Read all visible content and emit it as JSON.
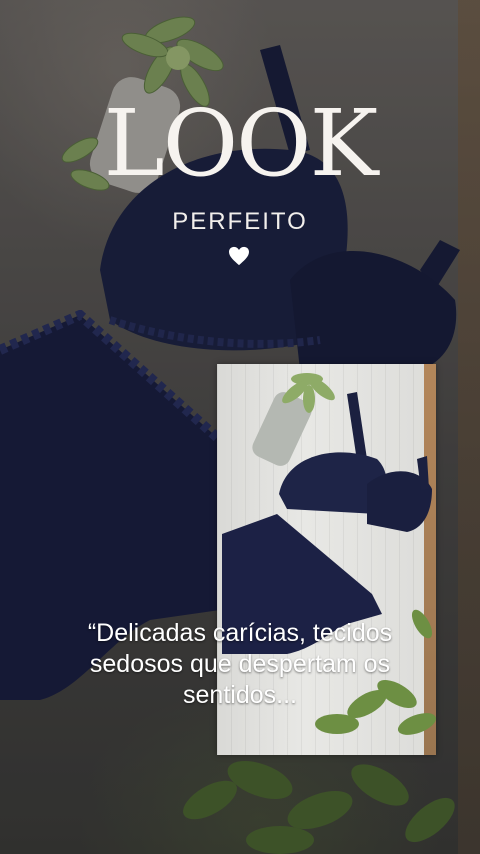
{
  "header": {
    "title": "LOOK",
    "subtitle": "PERFEITO",
    "heart_icon": "heart-icon"
  },
  "caption": {
    "line1": "“Delicadas carícias, tecidos",
    "line2": "sedosos que despertam os",
    "line3": "sentidos..."
  },
  "colors": {
    "text": "#ffffff",
    "garment": "#1e2447",
    "leaf": "#7e9b5c"
  }
}
